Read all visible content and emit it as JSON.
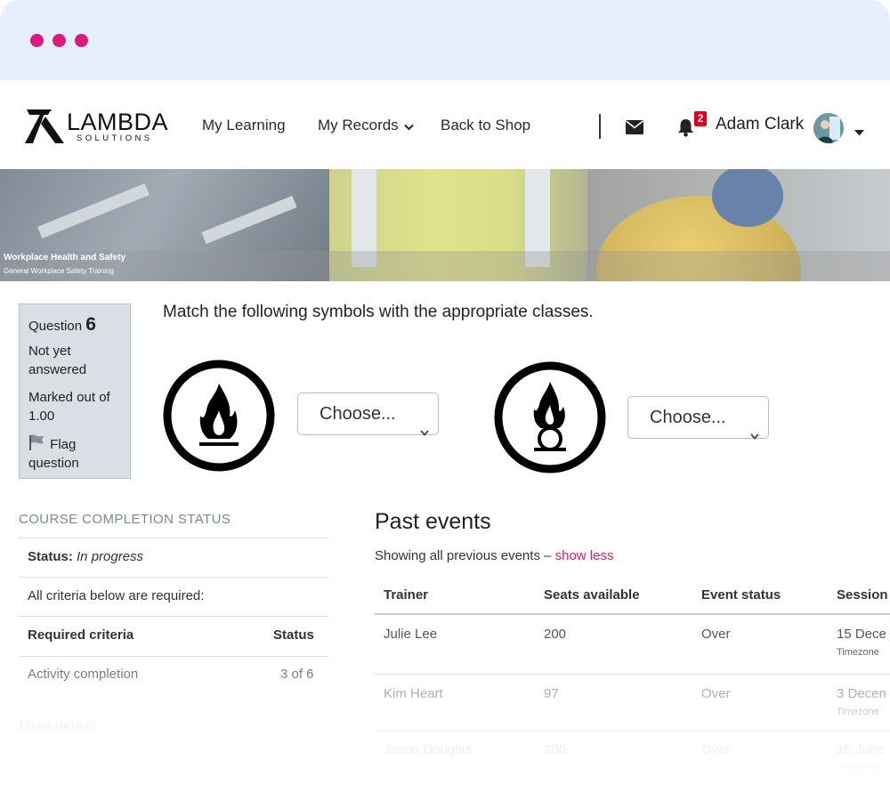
{
  "window": {
    "dot_color": "#d81b7d"
  },
  "logo": {
    "main": "LAMBDA",
    "sub": "SOLUTIONS"
  },
  "nav": {
    "items": [
      {
        "label": "My Learning"
      },
      {
        "label": "My Records"
      },
      {
        "label": "Back to Shop"
      }
    ],
    "notifications_count": "2",
    "user_name": "Adam Clark"
  },
  "banner": {
    "title": "Workplace Health and Safety",
    "subtitle": "General Workplace Safety Training"
  },
  "question": {
    "label": "Question",
    "number": "6",
    "state": "Not yet answered",
    "marked_out_of": "Marked out of 1.00",
    "flag_label": "Flag question",
    "text": "Match the following symbols with the appropriate classes.",
    "selects": [
      {
        "symbol": "flame-icon",
        "value": "Choose..."
      },
      {
        "symbol": "flame-over-circle-icon",
        "value": "Choose..."
      }
    ]
  },
  "course_completion": {
    "title": "COURSE COMPLETION STATUS",
    "status_label": "Status:",
    "status_value": "In progress",
    "criteria_note": "All criteria below are required:",
    "header_criteria": "Required criteria",
    "header_status": "Status",
    "rows": [
      {
        "criteria": "Activity completion",
        "status": "3 of 6"
      }
    ],
    "more_details": "More details"
  },
  "past_events": {
    "title": "Past events",
    "showing_text": "Showing all previous events –",
    "show_less": "show less",
    "columns": [
      "Trainer",
      "Seats available",
      "Event status",
      "Session"
    ],
    "rows": [
      {
        "trainer": "Julie Lee",
        "seats": "200",
        "status": "Over",
        "session": "15 Dece",
        "timezone": "Timezone"
      },
      {
        "trainer": "Kim Heart",
        "seats": "97",
        "status": "Over",
        "session": "3 Decen",
        "timezone": "Timezone"
      },
      {
        "trainer": "Jason Douglas",
        "seats": "200",
        "status": "Over",
        "session": "15 June",
        "timezone": "Timezone"
      }
    ]
  }
}
